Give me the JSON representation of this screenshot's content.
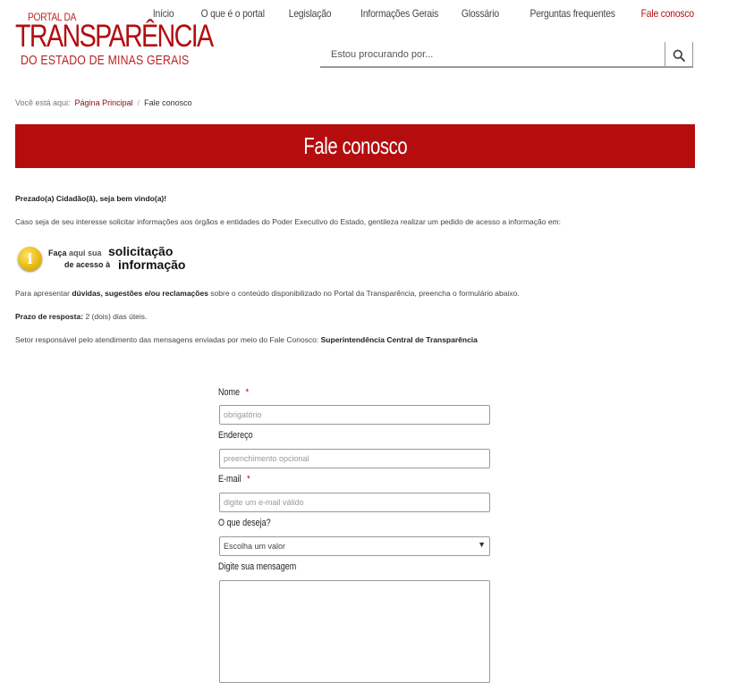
{
  "logo": {
    "small": "PORTAL DA",
    "big": "TRANSPARÊNCIA",
    "state": "DO ESTADO DE MINAS GERAIS"
  },
  "nav": [
    {
      "label": "Início"
    },
    {
      "label": "O que é o portal"
    },
    {
      "label": "Legislação"
    },
    {
      "label": "Informações Gerais"
    },
    {
      "label": "Glossário"
    },
    {
      "label": "Perguntas frequentes"
    },
    {
      "label": "Fale conosco",
      "active": true
    }
  ],
  "search": {
    "placeholder": "Estou procurando por...",
    "icon": "search-icon"
  },
  "breadcrumb": {
    "prefix": "Você está aqui:",
    "home": "Página Principal",
    "separator": "/",
    "current": "Fale conosco"
  },
  "banner": {
    "title": "Fale conosco"
  },
  "content": {
    "greeting": "Prezado(a) Cidadão(ã), seja bem vindo(a)!",
    "intro": "Caso seja de seu interesse solicitar informações aos órgãos e entidades do Poder Executivo do Estado, gentileza realizar um pedido de acesso a informação em:",
    "solicitation": {
      "line1a": "Faça",
      "line1b": "aqui sua",
      "line1c": "solicitação",
      "line2a": "de",
      "line2b": "acesso",
      "line2c": "à",
      "line2d": "informação"
    },
    "para1_pre": "Para  apresentar",
    "para1_bold": "dúvidas, sugestões e/ou reclamações",
    "para1_post": "sobre o conteúdo disponibilizado no Portal da Transparência, preencha o formulário abaixo.",
    "deadline_label": "Prazo de resposta:",
    "deadline_value": "2 (dois) dias úteis.",
    "sector_pre": "Setor responsável pelo atendimento das mensagens enviadas por meio do Fale Conosco:",
    "sector_bold": "Superintendência Central de Transparência"
  },
  "form": {
    "name_label": "Nome",
    "name_placeholder": "obrigatório",
    "address_label": "Endereço",
    "address_placeholder": "preenchimento opcional",
    "email_label": "E-mail",
    "email_placeholder": "digite um e-mail válido",
    "wish_label": "O que deseja?",
    "wish_value": "Escolha um valor",
    "message_label": "Digite sua mensagem",
    "required_mark": "*"
  }
}
